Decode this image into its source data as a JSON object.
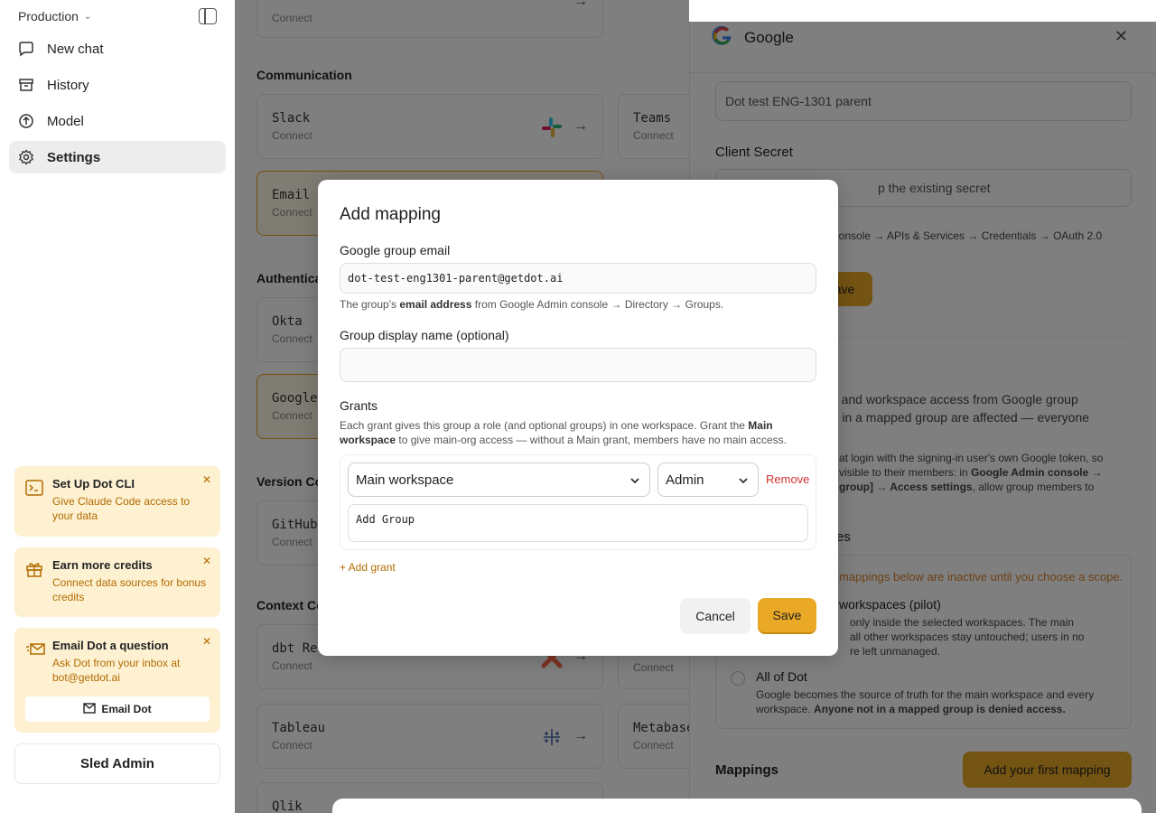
{
  "sidebar": {
    "workspace": "Production",
    "nav": [
      {
        "label": "New chat",
        "icon": "chat-icon"
      },
      {
        "label": "History",
        "icon": "archive-icon"
      },
      {
        "label": "Model",
        "icon": "arrow-up-circle-icon"
      },
      {
        "label": "Settings",
        "icon": "gear-icon",
        "active": true
      }
    ],
    "promos": [
      {
        "title": "Set Up Dot CLI",
        "desc": "Give Claude Code access to your data",
        "icon": "terminal-icon"
      },
      {
        "title": "Earn more credits",
        "desc": "Connect data sources for bonus credits",
        "icon": "gift-icon"
      },
      {
        "title": "Email Dot a question",
        "desc": "Ask Dot from your inbox at bot@getdot.ai",
        "icon": "mail-fast-icon",
        "button": "Email Dot"
      }
    ],
    "admin_label": "Sled Admin"
  },
  "main": {
    "top_card_connect": "Connect",
    "sections": {
      "communication": "Communication",
      "authentication": "Authenticat",
      "version_control": "Version Co",
      "context": "Context Co"
    },
    "cards": [
      {
        "name": "Slack",
        "status": "Connect"
      },
      {
        "name": "Teams",
        "status": "Connect"
      },
      {
        "name": "Email",
        "status": "Connect"
      },
      {
        "name": "Okta",
        "status": "Connect"
      },
      {
        "name": "Google",
        "status": "Connect"
      },
      {
        "name": "GitHub",
        "status": "Connect"
      },
      {
        "name": "dbt Re",
        "status": "Connect"
      },
      {
        "name": "",
        "status": "Connect"
      },
      {
        "name": "Tableau",
        "status": "Connect"
      },
      {
        "name": "Metabase",
        "status": "Connect"
      },
      {
        "name": "Qlik",
        "status": ""
      }
    ]
  },
  "drawer": {
    "title": "Google",
    "client_id_value": "Dot test ENG-1301 parent",
    "client_secret_label": "Client Secret",
    "client_secret_placeholder": "p the existing secret",
    "console_path": "Console → APIs & Services → Credentials → OAuth 2.0",
    "save_btn": "ave",
    "desc1": "ps, and workspace access from Google group",
    "desc2": "ers in a mapped group are affected — everyone",
    "desc3": ".",
    "desc4": "at login with the signing-in user's own Google token, so",
    "desc5a": "visible to their members: in",
    "desc5b": "Google Admin console →",
    "desc6a": "group] → Access settings",
    "desc6b": ", allow group members to",
    "scope_label": "es",
    "scope_warning": "mappings below are inactive until you choose a scope.",
    "opt1_title": "workspaces (pilot)",
    "opt1_l1": "only inside the selected workspaces. The main",
    "opt1_l2": "all other workspaces stay untouched; users in no",
    "opt1_l3": "re left unmanaged.",
    "opt2_title": "All of Dot",
    "opt2_l1": "Google becomes the source of truth for the main workspace and every",
    "opt2_l2a": "workspace.",
    "opt2_l2b": "Anyone not in a mapped group is denied access.",
    "mappings_label": "Mappings",
    "mappings_btn": "Add your first mapping"
  },
  "modal": {
    "title": "Add mapping",
    "email_label": "Google group email",
    "email_value": "dot-test-eng1301-parent@getdot.ai",
    "email_help_pre": "The group's",
    "email_help_bold": "email address",
    "email_help_post": "from Google Admin console → Directory → Groups.",
    "display_label": "Group display name (optional)",
    "display_value": "",
    "grants_label": "Grants",
    "grants_help_1": "Each grant gives this group a role (and optional groups) in one workspace. Grant the",
    "grants_help_bold": "Main workspace",
    "grants_help_2": "to give main-org access — without a Main grant, members have no main access.",
    "workspace_select": "Main workspace",
    "role_select": "Admin",
    "remove": "Remove",
    "add_group": "Add Group",
    "add_grant": "+ Add grant",
    "cancel": "Cancel",
    "save": "Save"
  }
}
